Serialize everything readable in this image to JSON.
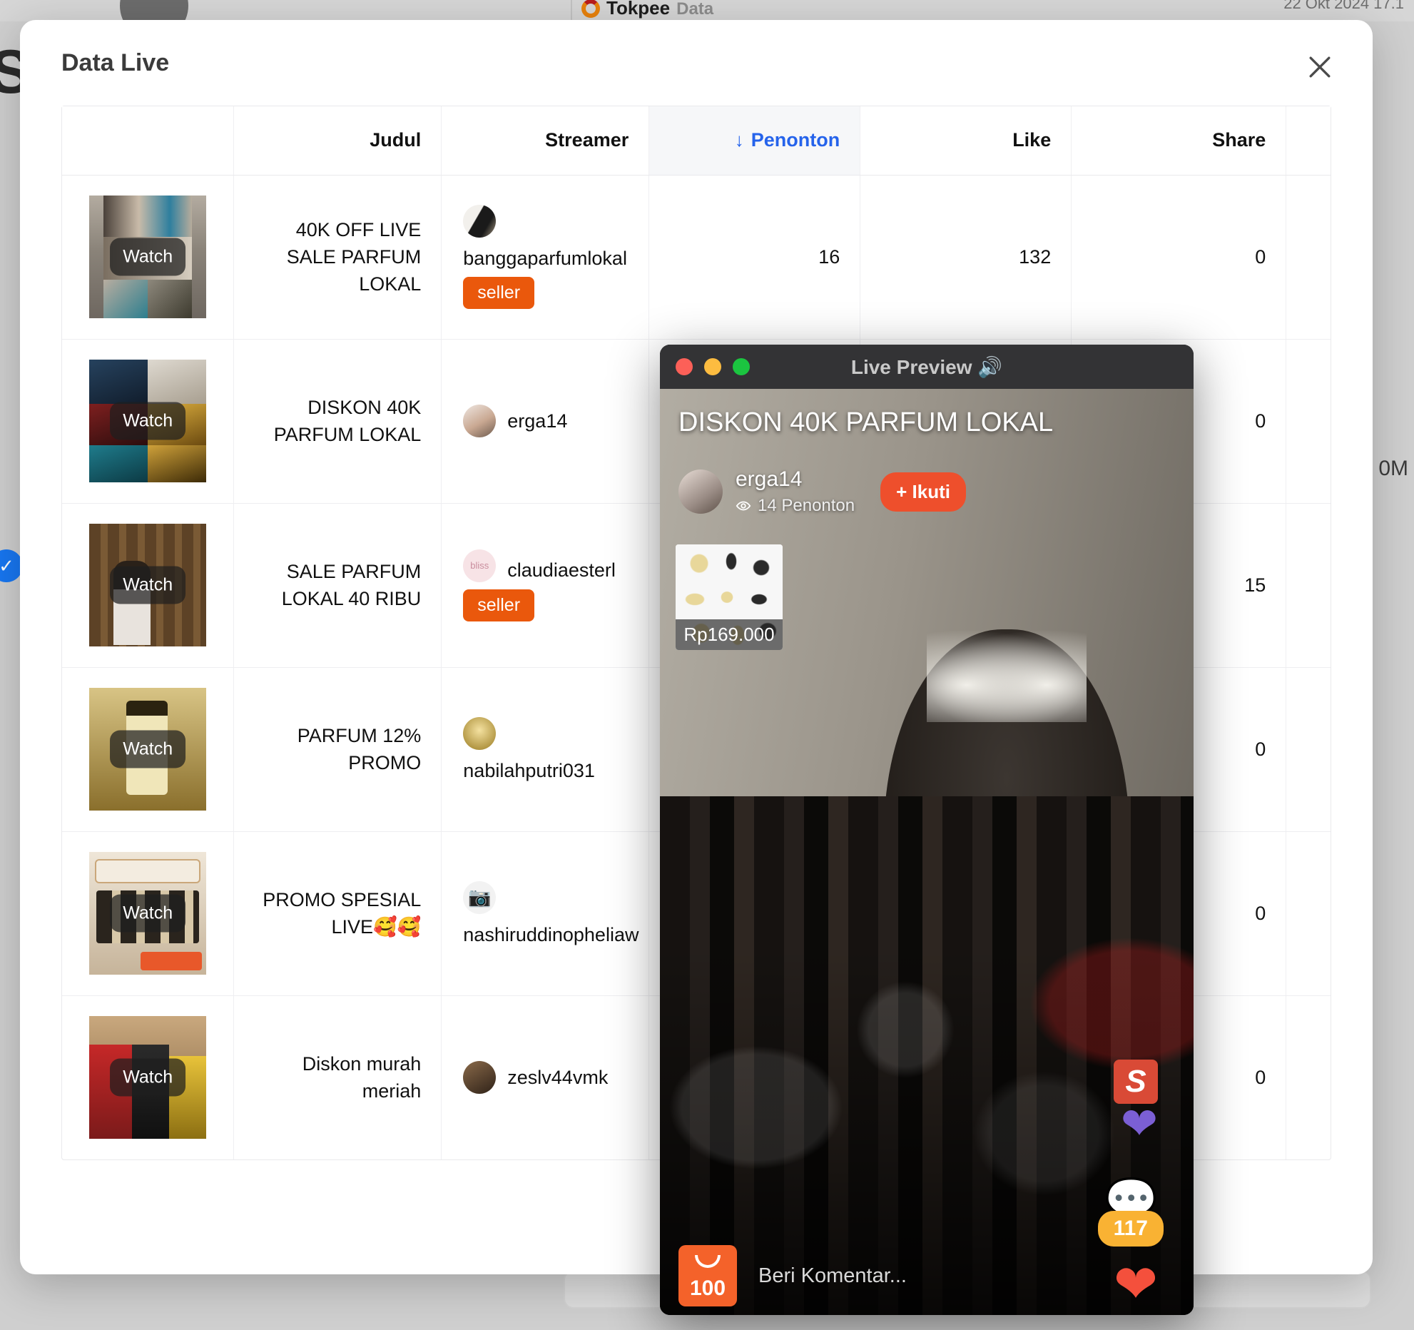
{
  "background": {
    "brand": "Tokpee",
    "brand_sub": "Data",
    "date": "22 Okt 2024 17.1",
    "big_text": "S",
    "metric_partial": "0M"
  },
  "modal": {
    "title": "Data Live",
    "close_label": "close-icon"
  },
  "table": {
    "columns": [
      {
        "key": "thumb",
        "label": ""
      },
      {
        "key": "judul",
        "label": "Judul"
      },
      {
        "key": "streamer",
        "label": "Streamer"
      },
      {
        "key": "penonton",
        "label": "Penonton",
        "sorted": true,
        "sort_arrow": "↓"
      },
      {
        "key": "like",
        "label": "Like"
      },
      {
        "key": "share",
        "label": "Share"
      }
    ],
    "watch_label": "Watch",
    "seller_badge": "seller",
    "rows": [
      {
        "judul": "40K OFF LIVE SALE PARFUM LOKAL",
        "streamer": "banggaparfumlokal",
        "is_seller": true,
        "avatar_broken": false,
        "penonton": "16",
        "like": "132",
        "share": "0"
      },
      {
        "judul": "DISKON 40K PARFUM LOKAL",
        "streamer": "erga14",
        "is_seller": false,
        "avatar_broken": false,
        "penonton": "",
        "like": "",
        "share": "0"
      },
      {
        "judul": "SALE PARFUM LOKAL 40 RIBU",
        "streamer": "claudiaesterl",
        "is_seller": true,
        "avatar_broken": false,
        "penonton": "",
        "like": "",
        "share": "15"
      },
      {
        "judul": "PARFUM 12% PROMO",
        "streamer": "nabilahputri031",
        "is_seller": false,
        "avatar_broken": false,
        "penonton": "",
        "like": "",
        "share": "0"
      },
      {
        "judul": "PROMO SPESIAL LIVE🥰🥰",
        "streamer": "nashiruddinopheliaw",
        "is_seller": false,
        "avatar_broken": true,
        "penonton": "",
        "like": "",
        "share": "0"
      },
      {
        "judul": "Diskon murah meriah",
        "streamer": "zeslv44vmk",
        "is_seller": false,
        "avatar_broken": false,
        "penonton": "",
        "like": "",
        "share": "0"
      }
    ]
  },
  "preview": {
    "window_title": "Live Preview 🔊",
    "stream_title": "DISKON 40K PARFUM LOKAL",
    "streamer_name": "erga14",
    "viewers": "14 Penonton",
    "follow_label": "+ Ikuti",
    "product_price": "Rp169.000",
    "shop_badge": "100",
    "comment_placeholder": "Beri Komentar...",
    "like_count": "117"
  },
  "colors": {
    "accent_blue": "#2563eb",
    "seller_orange": "#ea580c",
    "follow_red": "#ee4f2c",
    "count_yellow": "#f9b233",
    "heart_red": "#f4503c",
    "heart_purple": "#7b5fd4"
  }
}
